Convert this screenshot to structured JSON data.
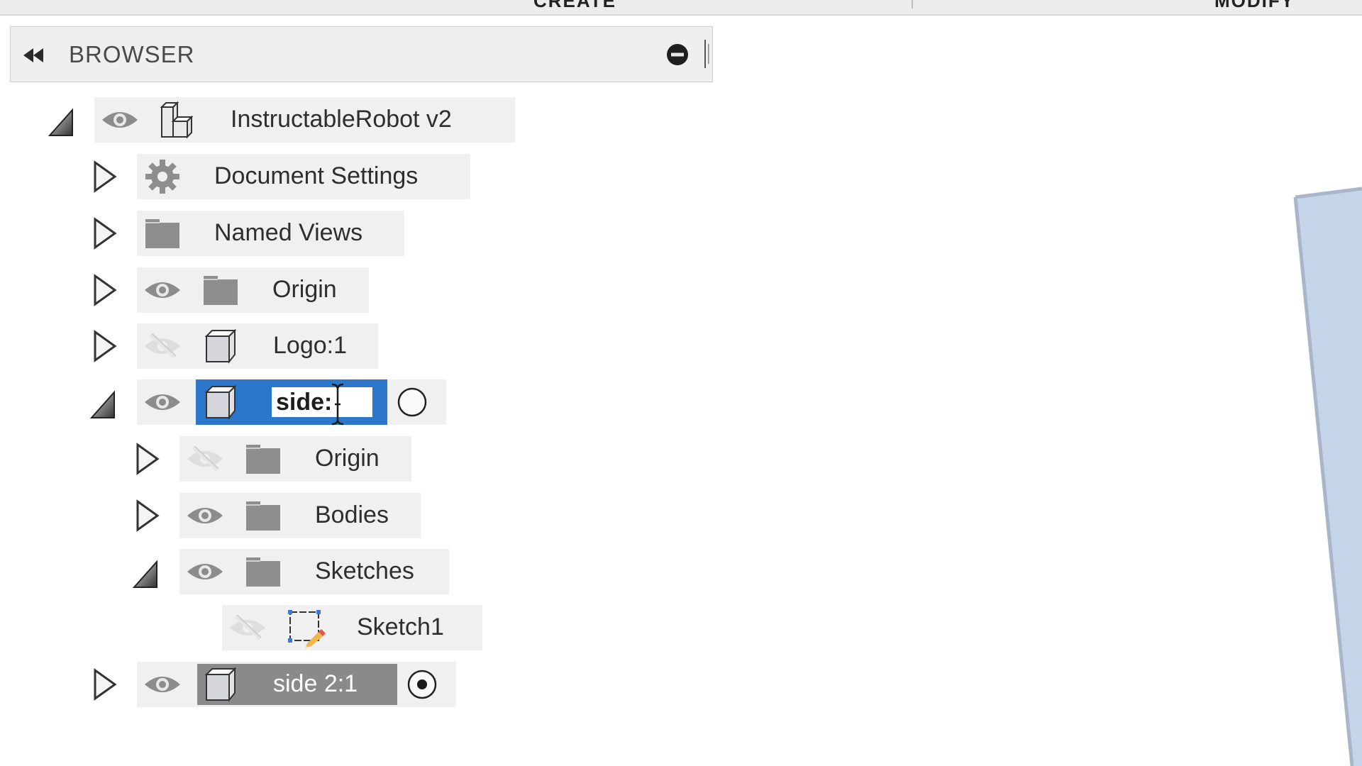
{
  "toolbar": {
    "create_label": "CREATE",
    "modify_label": "MODIFY"
  },
  "browser": {
    "title": "BROWSER",
    "collapse_icon": "double-left-arrow",
    "minus_icon": "minus-circle"
  },
  "tree": [
    {
      "label": "InstructableRobot v2",
      "level": 0,
      "expanded": true,
      "visible": true,
      "icon": "assembly-component-icon"
    },
    {
      "label": "Document Settings",
      "level": 1,
      "expanded": false,
      "visible": null,
      "icon": "gear-icon"
    },
    {
      "label": "Named Views",
      "level": 1,
      "expanded": false,
      "visible": null,
      "icon": "folder-icon"
    },
    {
      "label": "Origin",
      "level": 1,
      "expanded": false,
      "visible": true,
      "icon": "folder-icon"
    },
    {
      "label": "Logo:1",
      "level": 1,
      "expanded": false,
      "visible": false,
      "icon": "component-icon"
    },
    {
      "label": "side:",
      "level": 1,
      "expanded": true,
      "visible": true,
      "icon": "component-icon",
      "editing": true,
      "active_radio": false
    },
    {
      "label": "Origin",
      "level": 2,
      "expanded": false,
      "visible": false,
      "icon": "folder-icon"
    },
    {
      "label": "Bodies",
      "level": 2,
      "expanded": false,
      "visible": true,
      "icon": "folder-icon"
    },
    {
      "label": "Sketches",
      "level": 2,
      "expanded": true,
      "visible": true,
      "icon": "folder-icon"
    },
    {
      "label": "Sketch1",
      "level": 3,
      "expanded": null,
      "visible": false,
      "icon": "sketch-icon"
    },
    {
      "label": "side 2:1",
      "level": 1,
      "expanded": false,
      "visible": true,
      "icon": "component-icon",
      "selected": true,
      "active_radio": true
    }
  ],
  "colors": {
    "selection_blue": "#2c77c9",
    "selection_grey": "#8a8a8a",
    "row_bg": "#f0f0f0",
    "body_fill": "#c5d3e8",
    "body_edge": "#a8b6cc"
  }
}
